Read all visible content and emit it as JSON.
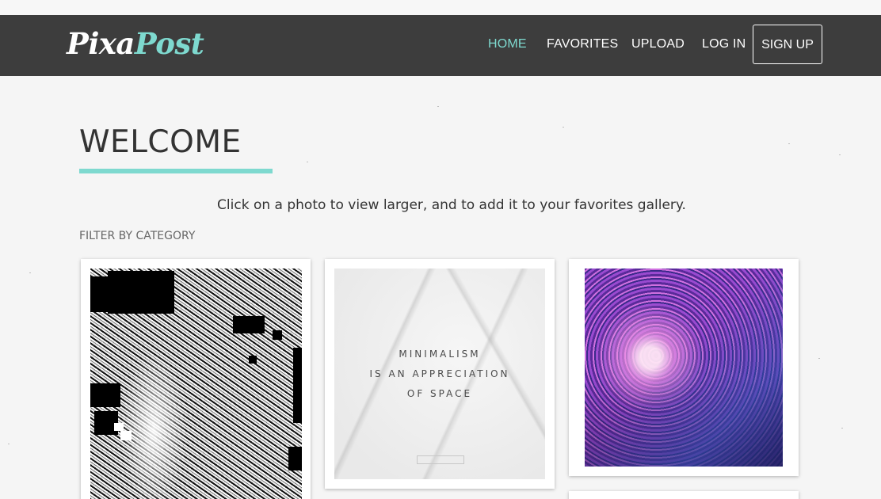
{
  "logo": {
    "part1": "Pixa",
    "part2": "Post"
  },
  "nav": {
    "home": "HOME",
    "favorites": "FAVORITES",
    "upload": "UPLOAD",
    "login": "LOG IN",
    "signup": "SIGN UP"
  },
  "main": {
    "title": "WELCOME",
    "intro": "Click on a photo to view larger, and to add it to your favorites gallery.",
    "filter_label": "FILTER BY CATEGORY"
  },
  "gallery": {
    "photo2_lines": [
      "MINIMALISM",
      "IS AN APPRECIATION",
      "OF SPACE"
    ]
  },
  "colors": {
    "accent": "#7ed9cf",
    "navbar": "#3d3d3d",
    "background": "#f5f5f5"
  }
}
